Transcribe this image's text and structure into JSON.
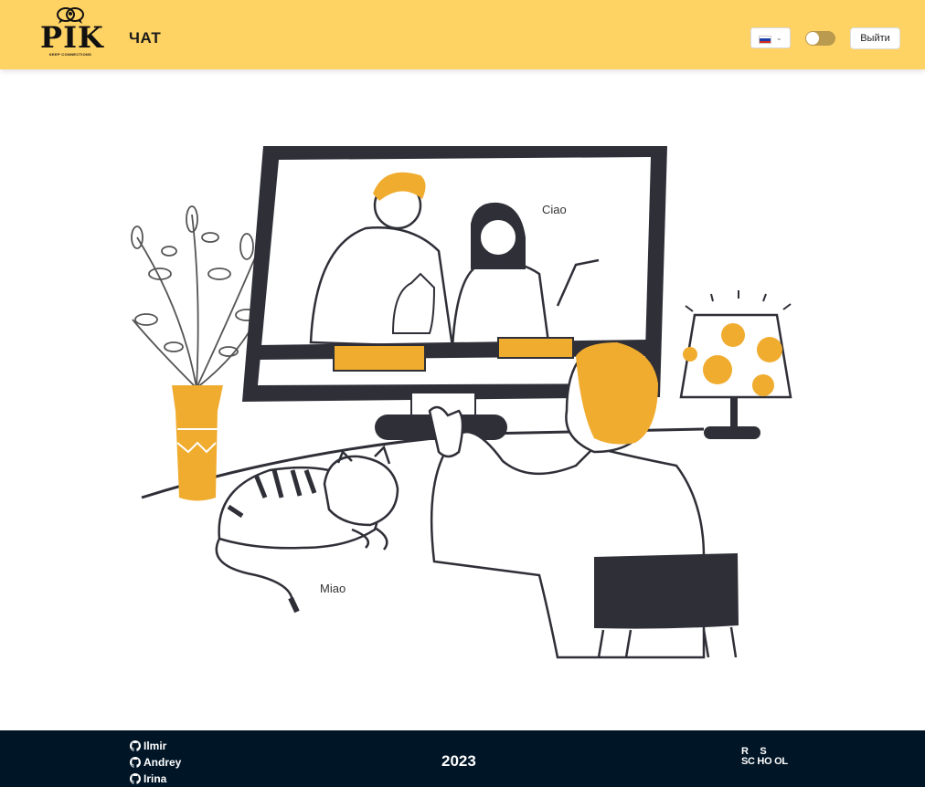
{
  "header": {
    "logo_text": "PIK",
    "logo_subtitle": "KEEP CONNECTIONS",
    "nav_title": "ЧАТ",
    "language": {
      "selected": "ru",
      "icon": "russian-flag-icon"
    },
    "theme_toggle": {
      "checked": false
    },
    "logout_label": "Выйти"
  },
  "main": {
    "bubble_person": "Ciao",
    "bubble_cat": "Miao"
  },
  "footer": {
    "developers": [
      {
        "name": "Ilmir",
        "icon": "github-icon"
      },
      {
        "name": "Andrey",
        "icon": "github-icon"
      },
      {
        "name": "Irina",
        "icon": "github-icon"
      }
    ],
    "year": "2023",
    "school_logo": {
      "line1": "R S",
      "line2": "SC HO OL"
    }
  },
  "colors": {
    "header_bg": "#ffd264",
    "accent": "#f0ac2f",
    "footer_bg": "#001526",
    "dark": "#2f2f38"
  }
}
